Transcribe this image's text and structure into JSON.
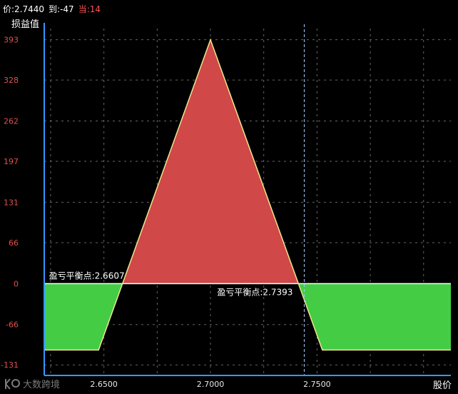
{
  "status": {
    "price_label": "价:",
    "price_value": "2.7440",
    "expire_label": "到:",
    "expire_value": "-47",
    "current_label": "当:",
    "current_value": "14"
  },
  "watermark": "大数跨境",
  "colors": {
    "profit": "#d04848",
    "loss": "#44cc44",
    "payoff_line": "#f0e68c",
    "axis": "#3399ff",
    "zero_line": "#ffffff",
    "grid": "#666666",
    "price_marker": "#aaccff"
  },
  "chart_data": {
    "type": "area",
    "title": "",
    "xlabel": "股价",
    "ylabel": "损益值",
    "xlim": [
      2.622,
      2.8128
    ],
    "ylim": [
      -148,
      411
    ],
    "grid": true,
    "y_ticks": [
      393,
      328,
      262,
      197,
      131,
      66,
      0,
      -66,
      -131
    ],
    "y_tick_labels": [
      "393",
      "328",
      "262",
      "197",
      "131",
      "66",
      "0",
      "-66",
      "-131"
    ],
    "x_ticks": [
      2.65,
      2.7,
      2.75
    ],
    "x_tick_labels": [
      "2.6500",
      "2.7000",
      "2.7500"
    ],
    "payoff": {
      "x": [
        2.622,
        2.6475,
        2.7,
        2.7525,
        2.8128
      ],
      "y": [
        -107,
        -107,
        393,
        -107,
        -107
      ]
    },
    "breakeven_points": [
      {
        "value": 2.6607,
        "label": "盈亏平衡点:2.6607"
      },
      {
        "value": 2.7393,
        "label": "盈亏平衡点:2.7393"
      }
    ],
    "current_price": 2.744
  }
}
